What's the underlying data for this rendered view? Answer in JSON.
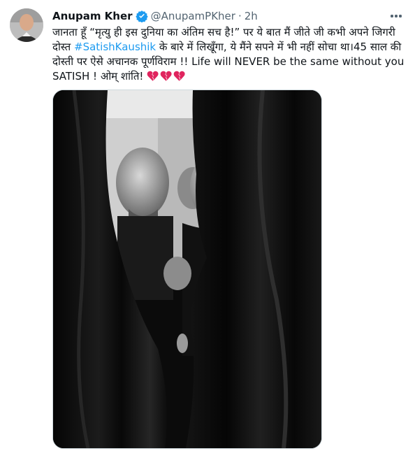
{
  "tweet": {
    "author_name": "Anupam Kher",
    "handle": "@AnupamPKher",
    "separator": "·",
    "time": "2h",
    "text_part1": "जानता हूँ “मृत्यु ही इस दुनिया का अंतिम सच है!” पर ये बात मैं जीते जी कभी अपने जिगरी दोस्त ",
    "hashtag": "#SatishKaushik",
    "text_part2": " के बारे में लिखूँगा, ये मैंने सपने में भी नहीं सोचा था।45 साल की दोस्ती पर ऐसे अचानक पूर्णविराम !! Life will NEVER be the same without you SATISH ! ओम् शांति! ",
    "emoji_icons": [
      "broken-heart",
      "broken-heart",
      "broken-heart"
    ]
  },
  "colors": {
    "text": "#0f1419",
    "muted": "#536471",
    "link": "#1d9bf0",
    "verified": "#1d9bf0",
    "heart": "#e0245e"
  },
  "icons": {
    "verified": "verified-badge-icon",
    "more": "more-horizontal-icon",
    "emoji": "broken-heart-icon"
  }
}
